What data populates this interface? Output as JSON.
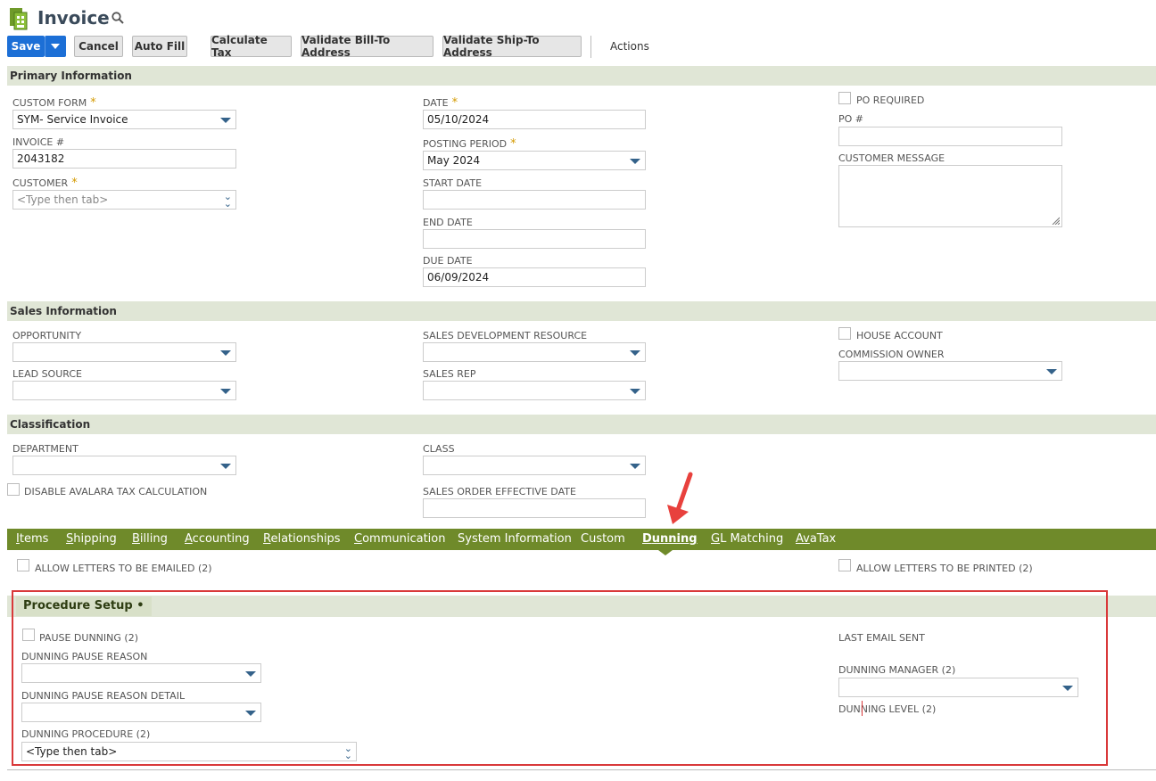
{
  "header": {
    "title": "Invoice"
  },
  "toolbar": {
    "save": "Save",
    "cancel": "Cancel",
    "auto_fill": "Auto Fill",
    "calculate_tax": "Calculate Tax",
    "validate_bill": "Validate Bill-To Address",
    "validate_ship": "Validate Ship-To Address",
    "actions": "Actions"
  },
  "primary": {
    "section": "Primary Information",
    "custom_form_label": "CUSTOM FORM",
    "custom_form_value": "SYM- Service Invoice",
    "invoice_label": "INVOICE #",
    "invoice_value": "2043182",
    "customer_label": "CUSTOMER",
    "customer_placeholder": "<Type then tab>",
    "date_label": "DATE",
    "date_value": "05/10/2024",
    "posting_label": "POSTING PERIOD",
    "posting_value": "May 2024",
    "start_label": "START DATE",
    "end_label": "END DATE",
    "due_label": "DUE DATE",
    "due_value": "06/09/2024",
    "po_required_label": "PO REQUIRED",
    "po_label": "PO #",
    "customer_message_label": "CUSTOMER MESSAGE"
  },
  "sales": {
    "section": "Sales Information",
    "opportunity_label": "OPPORTUNITY",
    "lead_source_label": "LEAD SOURCE",
    "sdr_label": "SALES DEVELOPMENT RESOURCE",
    "sales_rep_label": "SALES REP",
    "house_account_label": "HOUSE ACCOUNT",
    "commission_owner_label": "COMMISSION OWNER"
  },
  "classification": {
    "section": "Classification",
    "department_label": "DEPARTMENT",
    "disable_avalara_label": "DISABLE AVALARA TAX CALCULATION",
    "class_label": "CLASS",
    "soed_label": "SALES ORDER EFFECTIVE DATE"
  },
  "tabs": [
    {
      "first": "I",
      "rest": "tems"
    },
    {
      "first": "S",
      "rest": "hipping"
    },
    {
      "first": "B",
      "rest": "illing"
    },
    {
      "first": "A",
      "rest": "ccounting"
    },
    {
      "first": "R",
      "rest": "elationships"
    },
    {
      "first": "C",
      "rest": "ommunication"
    },
    {
      "first": "",
      "rest": "System Information"
    },
    {
      "first": "",
      "rest": "Custom"
    },
    {
      "first": "D",
      "rest": "unning"
    },
    {
      "first": "G",
      "rest": "L Matching"
    },
    {
      "first": "Av",
      "rest": "aTax"
    }
  ],
  "dunning": {
    "allow_email_label": "ALLOW LETTERS TO BE EMAILED (2)",
    "allow_print_label": "ALLOW LETTERS TO BE PRINTED (2)",
    "subtab_label": "Procedure Setup •",
    "pause_label": "PAUSE DUNNING (2)",
    "pause_reason_label": "DUNNING PAUSE REASON",
    "pause_detail_label": "DUNNING PAUSE REASON DETAIL",
    "procedure_label": "DUNNING PROCEDURE (2)",
    "procedure_placeholder": "<Type then tab>",
    "last_email_label": "LAST EMAIL SENT",
    "manager_label": "DUNNING MANAGER (2)",
    "level_label": "DUNNING LEVEL (2)"
  },
  "colors": {
    "primary_button": "#1c6fd6",
    "tab_bar": "#6f8a2a",
    "section_bg": "#e0e6d6",
    "highlight": "#d9393a"
  }
}
